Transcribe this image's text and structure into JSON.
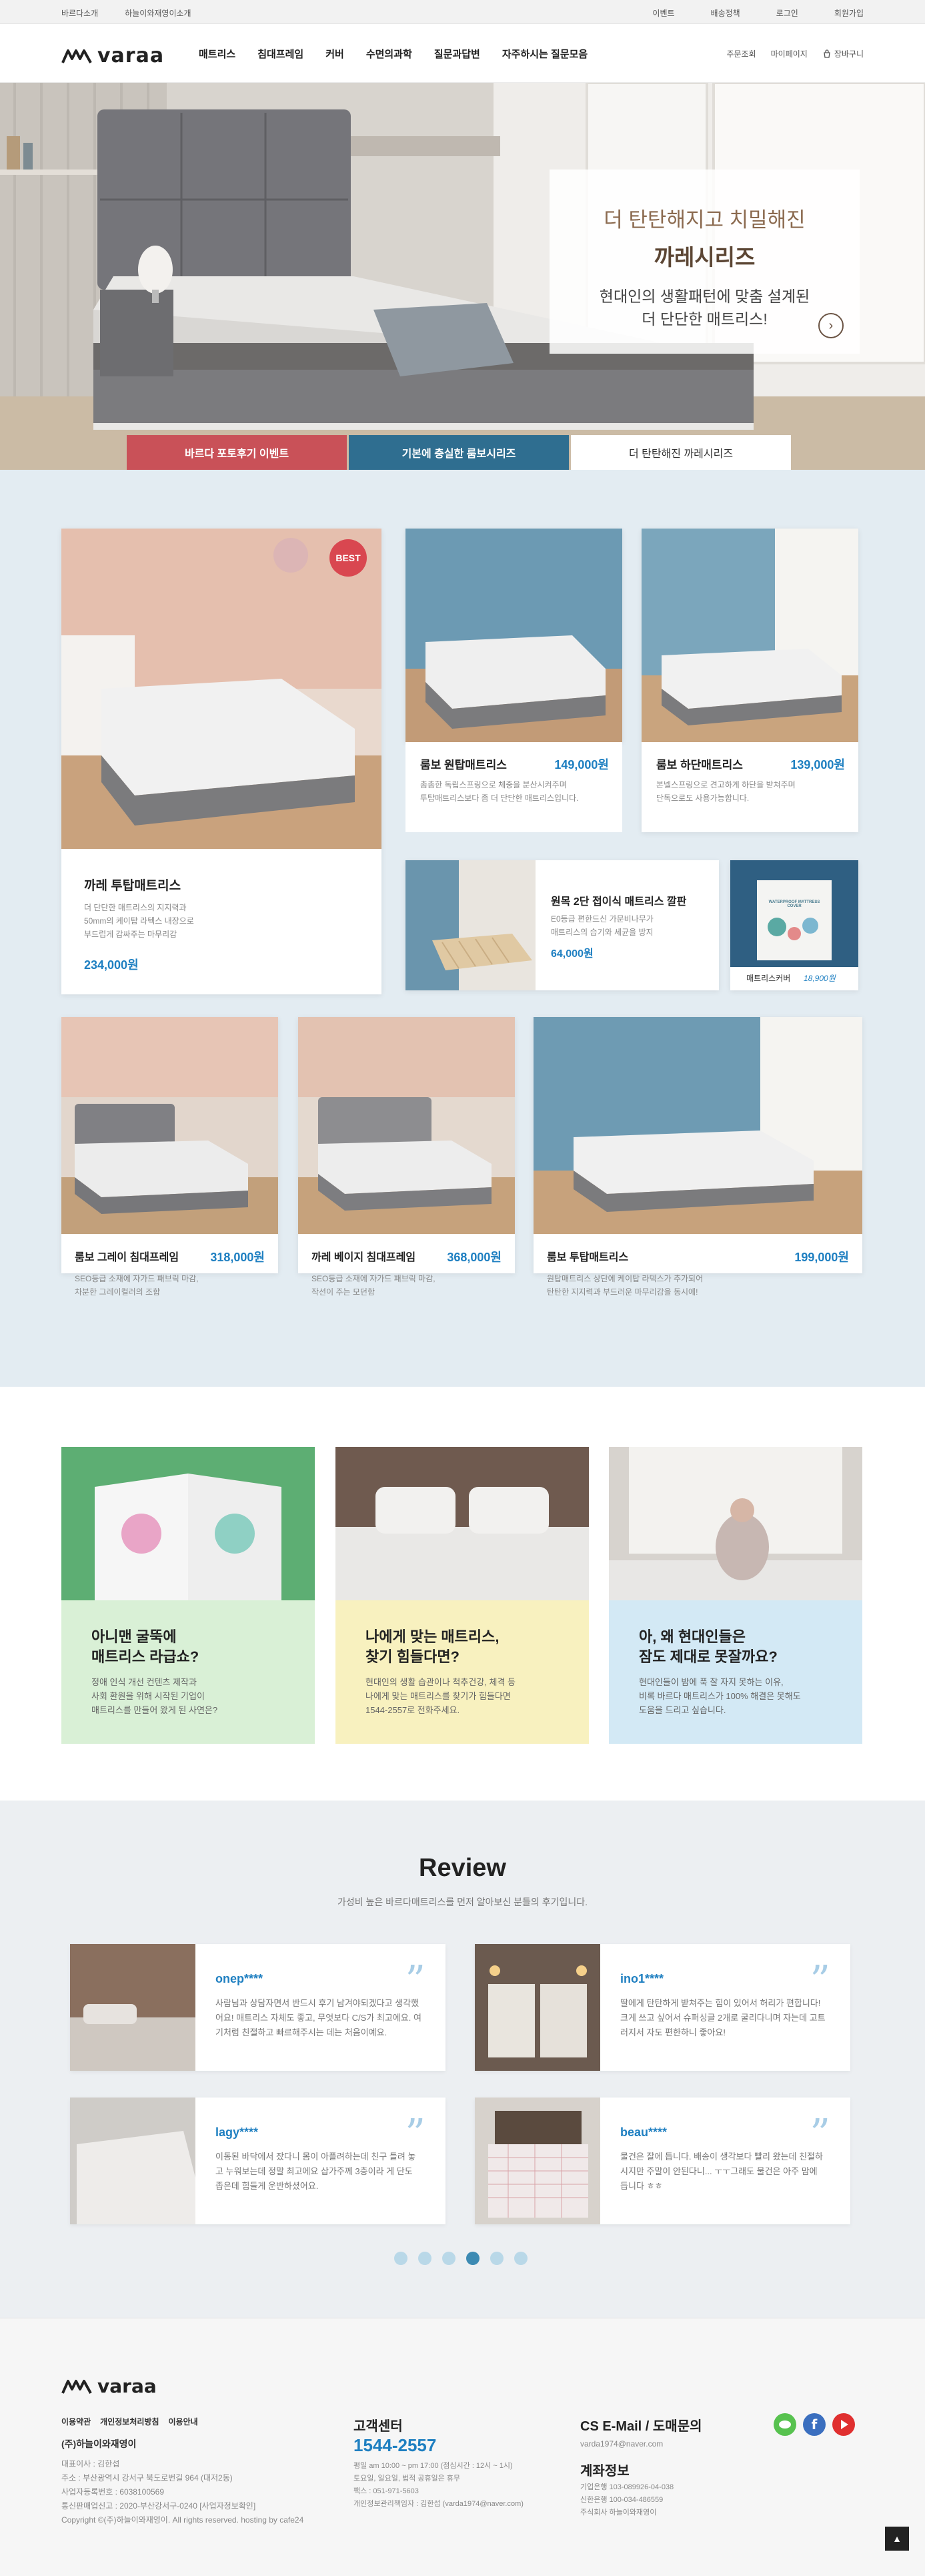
{
  "topbar": {
    "left": [
      "바르다소개",
      "하늘이와재영이소개"
    ],
    "right": [
      "이벤트",
      "배송정책",
      "로그인",
      "회원가입"
    ]
  },
  "header": {
    "logo": "varaa",
    "nav": [
      "매트리스",
      "침대프레임",
      "커버",
      "수면의과학",
      "질문과답변",
      "자주하시는 질문모음"
    ],
    "util": [
      "주문조회",
      "마이페이지",
      "장바구니"
    ]
  },
  "hero": {
    "title1": "더 탄탄해지고 치밀해진",
    "title2": "까레시리즈",
    "desc1": "현대인의 생활패턴에 맞춤 설계된",
    "desc2": "더 단단한 매트리스!",
    "tabs": [
      "바르다 포토후기 이벤트",
      "기본에 충실한 룸보시리즈",
      "더 탄탄해진 까레시리즈"
    ],
    "colors": {
      "tab1": "#c95158",
      "tab2": "#2f6e90",
      "tab3": "#ffffff"
    }
  },
  "products": {
    "best_badge": "BEST",
    "main": {
      "name": "까레 투탑매트리스",
      "desc1": "더 단단한 매트리스의 지지력과",
      "desc2": "50mm의 케이탑 라텍스 내장으로",
      "desc3": "부드럽게 감싸주는 마무리감",
      "price": "234,000원"
    },
    "p1": {
      "name": "룸보 원탑매트리스",
      "price": "149,000원",
      "desc1": "촘촘한 독립스프링으로 체중을 분산시켜주며",
      "desc2": "투탑매트리스보다 좀 더 단단한 매트리스입니다."
    },
    "p2": {
      "name": "룸보 하단매트리스",
      "price": "139,000원",
      "desc1": "본넬스프링으로 견고하게 하단을 받쳐주며",
      "desc2": "단독으로도 사용가능합니다."
    },
    "p3": {
      "name": "원목 2단 접이식 매트리스 깔판",
      "desc1": "E0등급 편한드신 가문비나무가",
      "desc2": "매트리스의 습기와 세균을 방지",
      "price": "64,000원"
    },
    "p4": {
      "name": "매트리스커버",
      "price": "18,900원",
      "box_label": "WATERPROOF MATTRESS COVER"
    },
    "p5": {
      "name": "룸보 그레이 침대프레임",
      "price": "318,000원",
      "desc1": "SEO등급 소재에 자가드 패브릭 마감,",
      "desc2": "차분한 그레이컬러의 조합"
    },
    "p6": {
      "name": "까레 베이지 침대프레임",
      "price": "368,000원",
      "desc1": "SEO등급 소재에 자가드 패브릭 마감,",
      "desc2": "작선이 주는 모던함"
    },
    "p7": {
      "name": "룸보 투탑매트리스",
      "price": "199,000원",
      "desc1": "원탑매트리스 상단에 케이탑 라텍스가 추가되어",
      "desc2": "탄탄한 지지력과 부드러운 마무리감을 동시에!"
    }
  },
  "features": [
    {
      "title1": "아니맨 굴뚝에",
      "title2": "매트리스 라급쇼?",
      "d1": "정애 인식 개선 컨텐츠 제작과",
      "d2": "사회 환원을 위해 시작된 기업이",
      "d3": "매트리스를 만들어 왔게 된 사연은?",
      "bg": "#d9f0d6"
    },
    {
      "title1": "나에게 맞는 매트리스,",
      "title2": "찾기 힘들다면?",
      "d1": "현대인의 생활 습관이나 척추건강, 체격 등",
      "d2": "나에게 맞는 매트리스를 찾기가 힘들다면",
      "d3": "1544-2557로 전화주세요.",
      "bg": "#f8f1bf"
    },
    {
      "title1": "아, 왜 현대인들은",
      "title2": "잠도 제대로 못잘까요?",
      "d1": "현대인들이 밤에 푹 잘 자지 못하는 이유,",
      "d2": "비록 바르다 매트리스가 100% 해결은 못해도",
      "d3": "도움을 드리고 싶습니다.",
      "bg": "#d3e9f5"
    }
  ],
  "review": {
    "title": "Review",
    "subtitle": "가성비 높은 바르다매트리스를 먼저 알아보신 분들의 후기입니다.",
    "quote": "”",
    "items": [
      {
        "name": "onep****",
        "text": "사람님과 상담자면서 반드시 후기 남겨야되겠다고 생각했어요! 매트리스 자체도 좋고, 무엇보다 C/S가 최고에요. 여기처럼 친절하고 빠르해주시는 데는 처음이예요."
      },
      {
        "name": "ino1****",
        "text": "딸에게 탄탄하게 받쳐주는 힘이 있어서 허리가 편합니다! 크게 쓰고 싶어서 슈퍼싱글 2개로 굴리다니며 자는데 고트러지서 자도 편한하니 좋아요!"
      },
      {
        "name": "lagy****",
        "text": "이동된 바닥에서 잤다니 몸이 아플려하는데 친구 들려 놓고 누워보는데 정말 최고에요 삽가주께 3층이라 게 단도 좁은데 힘들게 운반하셨어요."
      },
      {
        "name": "beau****",
        "text": "물건은 잘에 듭니다. 배송이 생각보다 빨리 왔는데 친절하시지만 주말이 안된다니... ㅜㅜ그래도 물건은 아주 맘에 듭니다 ㅎㅎ"
      }
    ]
  },
  "footer": {
    "logo": "varaa",
    "links": [
      "이용약관",
      "개인정보처리방침",
      "이용안내"
    ],
    "company": "(주)하늘이와재영이",
    "info": [
      "대표이사 : 김한섭",
      "주소 : 부산광역시 강서구 북도로번길 964 (대저2동)",
      "사업자등록번호 : 6038100569",
      "통신판매업신고 : 2020-부산강서구-0240 [사업자정보확인]",
      "Copyright ©(주)하늘이와재영이. All rights reserved. hosting by cafe24"
    ],
    "cs_title": "고객센터",
    "cs_phone": "1544-2557",
    "cs_info": [
      "평일 am 10:00 ~ pm 17:00 (점심시간 : 12시 ~ 1시)",
      "토요일, 일요일, 법적 공휴일은 휴무",
      "팩스 : 051-971-5603",
      "개인정보관리책임자 : 김한섭 (varda1974@naver.com)"
    ],
    "email_title": "CS E-Mail / 도매문의",
    "email": "varda1974@naver.com",
    "bank_title": "계좌정보",
    "bank": [
      "기업은행 103-089926-04-038",
      "신한은행 100-034-486559",
      "주식회사 하늘이와재영이"
    ],
    "sns_colors": {
      "talk": "#57c24f",
      "fb": "#3b6fbf",
      "yt": "#e03030"
    }
  }
}
